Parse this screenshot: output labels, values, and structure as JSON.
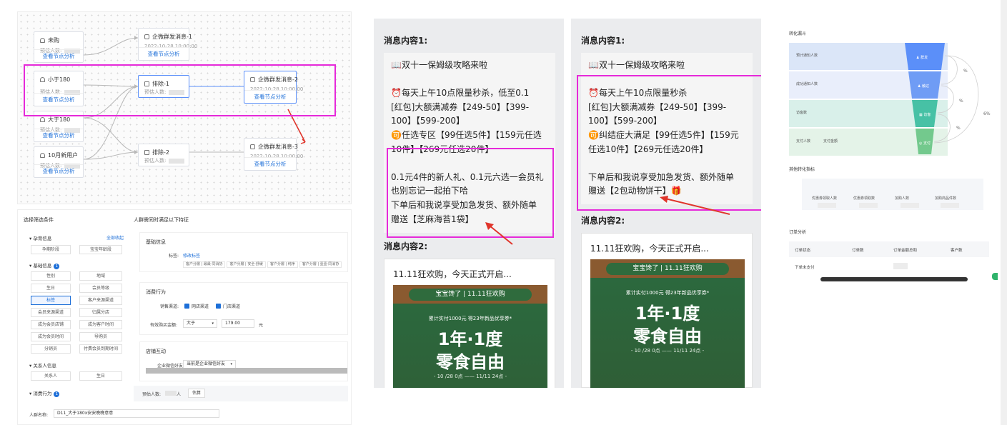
{
  "flow": {
    "nodes": [
      {
        "title": "未购",
        "sub": "预估人数:",
        "action": "查看节点分析"
      },
      {
        "title": "小于180",
        "sub": "预估人数:",
        "action": "查看节点分析"
      },
      {
        "title": "大于180",
        "sub": "预估人数:",
        "action": "查看节点分析"
      },
      {
        "title": "10月新用户",
        "sub": "预估人数:",
        "action": "查看节点分析"
      }
    ],
    "msg_nodes": [
      {
        "title": "企微群发消息-1",
        "time": "2022-10-28 10:00:00",
        "action": "查看节点分析"
      },
      {
        "title": "企微群发消息-2",
        "time": "2022-10-28 10:00:00",
        "action": "查看节点分析"
      },
      {
        "title": "企微群发消息-3",
        "time": "2022-10-28 10:00:00",
        "action": "查看节点分析"
      }
    ],
    "exclude_nodes": [
      {
        "title": "排除-1",
        "sub": "预估人数:"
      },
      {
        "title": "排除-2",
        "sub": "预估人数:"
      }
    ]
  },
  "cond": {
    "left_title": "选择筛选条件",
    "right_title": "人群需同时满足以下特征",
    "groups": [
      {
        "name": "孕育信息",
        "action": "全部收起",
        "items": [
          "孕期阶段",
          "宝宝年龄段"
        ]
      },
      {
        "name": "基础信息",
        "badge": "1",
        "items": [
          "性别",
          "地域",
          "生日",
          "会员等级",
          "标签",
          "客户来源渠道",
          "会员来源渠道",
          "归属分店",
          "成为会员店铺",
          "成为客户时间",
          "成为会员时间",
          "导购员",
          "分销员",
          "付费会员到期时间"
        ]
      },
      {
        "name": "关系人信息",
        "items": [
          "关系人",
          "生日"
        ]
      },
      {
        "name": "消费行为",
        "badge": "1"
      }
    ],
    "basic": {
      "title": "基础信息",
      "label": "标签:",
      "edit": "修改标签",
      "chips": [
        "客户分層 | 最最·同消协",
        "客户分層 | 安全·舒缓",
        "客户分層 | 纯净",
        "客户分層 | 壹壹·同消协"
      ]
    },
    "consume": {
      "title": "消费行为",
      "channel_label": "销售渠道:",
      "ch1": "网店渠道",
      "ch2": "门店渠道",
      "amount_label": "有效购买金额:",
      "op": "大于",
      "amount": "179.00",
      "unit": "元"
    },
    "store": {
      "title": "店铺互动",
      "label": "企业微信好友:",
      "value": "当前是企业微信好友"
    },
    "estimate_label": "预估人数:",
    "estimate_unit": "人",
    "estimate_btn": "估算",
    "name_label": "人群名称:",
    "name_value": "D11_大于180x安安晚晚意意"
  },
  "messages": [
    {
      "label1": "消息内容1:",
      "lines": [
        "📖双十一保姆级攻略来啦",
        "",
        "⏰每天上午10点限量秒杀，低至0.1",
        "[红包]大额满减券【249-50】【399-",
        "100】【599-200】",
        "🉑任选专区【99任选5件】【159元任选",
        "10件】【269元任选20件】",
        "",
        "0.1元4件的新人礼、0.1元六选一会员礼",
        "也别忘记一起拍下哈",
        "下单后和我说享受加急发货、额外随单",
        "赠送【芝麻海苔1袋】"
      ],
      "label2": "消息内容2:",
      "m2_title": "11.11狂欢购，今天正式开启...",
      "poster_top": "宝宝馋了 | 11.11狂欢购",
      "poster_small": "累计实付1000元 得23年新品优享券*",
      "poster_big1": "1年·1度",
      "poster_big2": "零食自由",
      "poster_date": "- 10 /28 0点 —— 11/11 24点 -"
    },
    {
      "label1": "消息内容1:",
      "lines": [
        "📖双十一保姆级攻略来啦",
        "",
        "⏰每天上午10点限量秒杀",
        "[红包]大额满减券【249-50】【399-",
        "100】【599-200】",
        "🉑纠结症大满足【99任选5件】【159元",
        "任选10件】【269元任选20件】",
        "",
        "下单后和我说享受加急发货、额外随单",
        "赠送【2包动物饼干】🎁"
      ],
      "label2": "消息内容2:",
      "m2_title": "11.11狂欢购，今天正式开启...",
      "poster_top": "宝宝馋了 | 11.11狂欢购",
      "poster_small": "累计实付1000元 得23年新品优享券*",
      "poster_big1": "1年·1度",
      "poster_big2": "零食自由",
      "poster_date": "- 10 /28 0点 —— 11/11 24点 -"
    }
  ],
  "funnel": {
    "title": "转化漏斗",
    "stages": [
      {
        "label": "预计通知人数",
        "badge": "群发",
        "pct": "%"
      },
      {
        "label": "成功通知人数",
        "badge": "触达",
        "pct": "%"
      },
      {
        "label": "访客数",
        "badge": "访客",
        "pct": "%"
      },
      {
        "label": "支付人数",
        "label2": "支付金额",
        "badge": "支付"
      }
    ],
    "side_pct": "6%",
    "other_title": "其他转化指标",
    "other_stats": [
      "优惠券领取人数",
      "优惠券领取数",
      "加购人数",
      "加购商品件数"
    ],
    "order_title": "订单分析",
    "order_headers": [
      "订单状态",
      "订单数",
      "订单金额总和",
      "客户数"
    ],
    "order_row": "下单未支付",
    "colors": {
      "band1": "#dbe6f8",
      "band2": "#e9eefb",
      "band3": "#d9f0ea",
      "band4": "#e4f3e8",
      "f1": "#5b8ff9",
      "f2": "#6f9cf5",
      "f3": "#47c1a5",
      "f4": "#73c98d"
    }
  }
}
